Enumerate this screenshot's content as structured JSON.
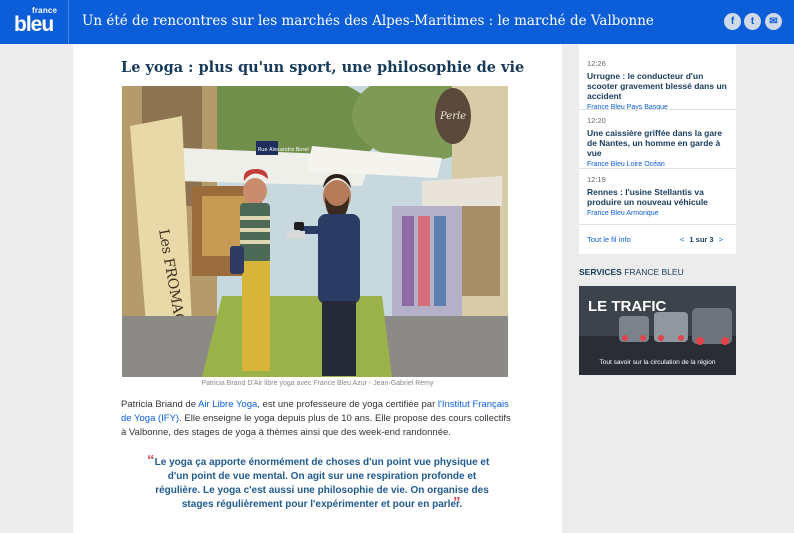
{
  "header": {
    "logo_small": "france",
    "logo_big": "bleu",
    "title": "Un été de rencontres sur les marchés des Alpes-Maritimes : le marché de Valbonne",
    "social": [
      {
        "label": "f",
        "icon": "facebook-icon"
      },
      {
        "label": "t",
        "icon": "twitter-icon"
      },
      {
        "label": "✉",
        "icon": "mail-icon"
      }
    ]
  },
  "article": {
    "title": "Le yoga : plus qu'un sport, une philosophie de vie",
    "photo_sign": "Perle",
    "photo_street": "Rue Alexandre Borel",
    "photo_awning": "Les FROMAGES",
    "caption": "Patricia Brand D'Air libre yoga avec France Bleu Azur - Jean-Gabriel Remy",
    "p_name": "Patricia Briand de",
    "p_link1": "Air Libre Yoga",
    "p_mid": ", est une professeure de yoga certifiée par",
    "p_link2": "l'Institut Français de Yoga (IFY)",
    "p_end": ". Elle enseigne le yoga depuis plus de 10 ans.  Elle propose des cours collectifs à Valbonne, des stages de yoga à thèmes ainsi que des week-end randonnée.",
    "quote_open": "“",
    "quote": "Le yoga ça apporte énormément de choses d'un point vue physique et d'un point de vue mental. On agit sur une respiration profonde et régulière. Le yoga c'est aussi une philosophie de vie. On organise des stages régulièrement pour l'expérimenter et pour en parler.",
    "quote_close": "”"
  },
  "sidebar": {
    "news": [
      {
        "time": "12:26",
        "headline": "Urrugne : le conducteur d'un scooter gravement blessé dans un accident",
        "source": "France Bleu Pays Basque"
      },
      {
        "time": "12:20",
        "headline": "Une caissière griffée dans la gare de Nantes, un homme en garde à vue",
        "source": "France Bleu Loire Océan"
      },
      {
        "time": "12:19",
        "headline": "Rennes : l'usine Stellantis va produire un nouveau véhicule",
        "source": "France Bleu Armorique"
      }
    ],
    "all_news": "Tout le fil info",
    "pager_prev": "<",
    "pager_text": "1 sur 3",
    "pager_next": ">",
    "services_bold": "SERVICES",
    "services_rest": " FRANCE BLEU",
    "traffic_title": "LE TRAFIC",
    "traffic_sub": "Tout savoir sur la circulation de la région"
  },
  "colors": {
    "brand": "#0b5ed7",
    "title": "#183a5a",
    "quote": "#1f5a8f",
    "quote_mark": "#e0455c"
  }
}
